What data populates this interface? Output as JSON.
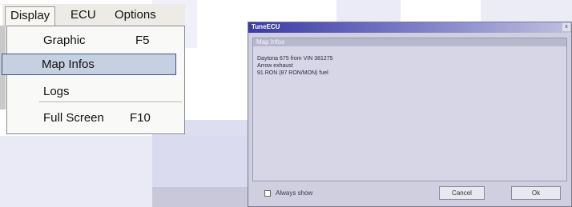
{
  "menubar": {
    "items": [
      "Display",
      "ECU",
      "Options"
    ]
  },
  "dropdown": {
    "items": [
      {
        "label": "Graphic",
        "shortcut": "F5"
      },
      {
        "label": "Map Infos",
        "shortcut": ""
      },
      {
        "label": "Logs",
        "shortcut": ""
      },
      {
        "label": "Full Screen",
        "shortcut": "F10"
      }
    ]
  },
  "dialog": {
    "title": "TuneECU",
    "close_label": "x",
    "group_title": "Map Infos",
    "info_lines": [
      "Daytona 675 from VIN 381275",
      "Arrow exhaust",
      "91 RON (87 RON/MON) fuel"
    ],
    "checkbox_label": "Always show",
    "cancel_label": "Cancel",
    "ok_label": "Ok"
  }
}
